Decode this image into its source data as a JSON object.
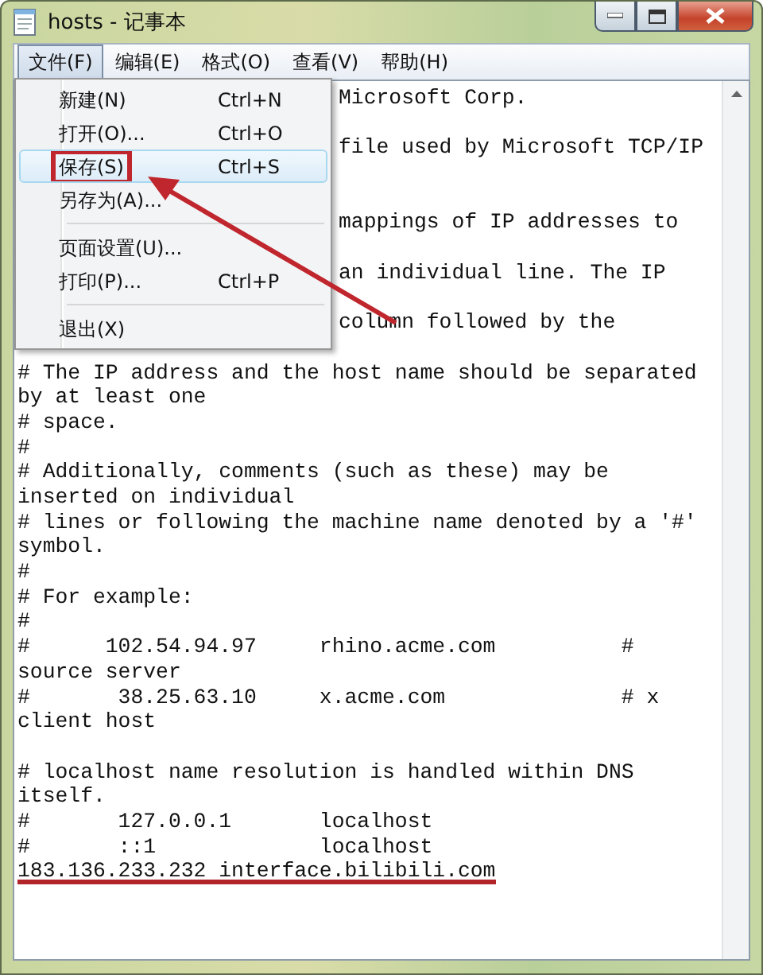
{
  "window": {
    "title": "hosts - 记事本"
  },
  "menu_bar": [
    {
      "label": "文件(F)",
      "selected": true
    },
    {
      "label": "编辑(E)",
      "selected": false
    },
    {
      "label": "格式(O)",
      "selected": false
    },
    {
      "label": "查看(V)",
      "selected": false
    },
    {
      "label": "帮助(H)",
      "selected": false
    }
  ],
  "file_menu": [
    {
      "kind": "item",
      "label": "新建(N)",
      "shortcut": "Ctrl+N",
      "selected": false,
      "annotated": false
    },
    {
      "kind": "item",
      "label": "打开(O)...",
      "shortcut": "Ctrl+O",
      "selected": false,
      "annotated": false
    },
    {
      "kind": "item",
      "label": "保存(S)",
      "shortcut": "Ctrl+S",
      "selected": true,
      "annotated": true
    },
    {
      "kind": "item",
      "label": "另存为(A)...",
      "selected": false,
      "annotated": false
    },
    {
      "kind": "separator"
    },
    {
      "kind": "item",
      "label": "页面设置(U)...",
      "selected": false,
      "annotated": false
    },
    {
      "kind": "item",
      "label": "打印(P)...",
      "shortcut": "Ctrl+P",
      "selected": false,
      "annotated": false
    },
    {
      "kind": "separator"
    },
    {
      "kind": "item",
      "label": "退出(X)",
      "selected": false,
      "annotated": false
    }
  ],
  "editor_lines": [
    {
      "kind": "text",
      "text": "Microsoft Corp.",
      "behind_menu": true
    },
    {
      "kind": "blank"
    },
    {
      "kind": "text",
      "text": "file used by Microsoft TCP/IP",
      "behind_menu": true
    },
    {
      "kind": "blank"
    },
    {
      "kind": "blank"
    },
    {
      "kind": "text",
      "text": "mappings of IP addresses to",
      "behind_menu": true
    },
    {
      "kind": "blank"
    },
    {
      "kind": "text",
      "text": "an individual line. The IP",
      "behind_menu": true
    },
    {
      "kind": "blank"
    },
    {
      "kind": "text",
      "text": "column followed by the",
      "behind_menu": true
    },
    {
      "kind": "blank"
    },
    {
      "kind": "text",
      "text": "# The IP address and the host name should be separated"
    },
    {
      "kind": "text",
      "text": "by at least one"
    },
    {
      "kind": "text",
      "text": "# space."
    },
    {
      "kind": "text",
      "text": "#"
    },
    {
      "kind": "text",
      "text": "# Additionally, comments (such as these) may be"
    },
    {
      "kind": "text",
      "text": "inserted on individual"
    },
    {
      "kind": "text",
      "text": "# lines or following the machine name denoted by a '#'"
    },
    {
      "kind": "text",
      "text": "symbol."
    },
    {
      "kind": "text",
      "text": "#"
    },
    {
      "kind": "text",
      "text": "# For example:"
    },
    {
      "kind": "text",
      "text": "#"
    },
    {
      "kind": "text",
      "text": "#      102.54.94.97     rhino.acme.com          #"
    },
    {
      "kind": "text",
      "text": "source server"
    },
    {
      "kind": "text",
      "text": "#       38.25.63.10     x.acme.com              # x"
    },
    {
      "kind": "text",
      "text": "client host"
    },
    {
      "kind": "blank"
    },
    {
      "kind": "text",
      "text": "# localhost name resolution is handled within DNS"
    },
    {
      "kind": "text",
      "text": "itself."
    },
    {
      "kind": "text",
      "text": "#       127.0.0.1       localhost"
    },
    {
      "kind": "text",
      "text": "#       ::1             localhost"
    },
    {
      "kind": "text",
      "text": "183.136.233.232 interface.bilibili.com",
      "underlined": true
    }
  ]
}
